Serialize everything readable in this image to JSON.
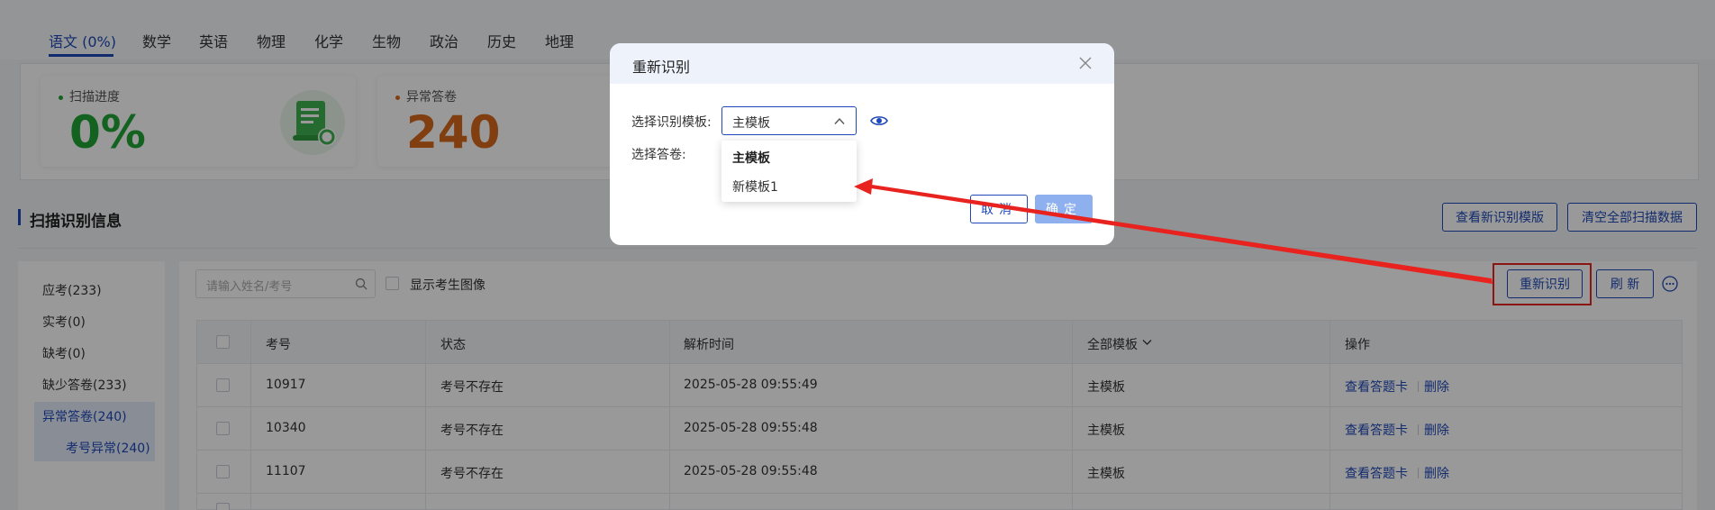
{
  "tabs": [
    {
      "label": "语文 (0%)",
      "active": true
    },
    {
      "label": "数学"
    },
    {
      "label": "英语"
    },
    {
      "label": "物理"
    },
    {
      "label": "化学"
    },
    {
      "label": "生物"
    },
    {
      "label": "政治"
    },
    {
      "label": "历史"
    },
    {
      "label": "地理"
    }
  ],
  "stats": {
    "scan_progress": {
      "label": "扫描进度",
      "value": "0%",
      "color": "#21a335"
    },
    "abnormal": {
      "label": "异常答卷",
      "value": "240",
      "color": "#d8681c"
    }
  },
  "section": {
    "title": "扫描识别信息",
    "view_new_template_btn": "查看新识别模版",
    "clear_all_btn": "清空全部扫描数据"
  },
  "sidebar": {
    "items": [
      {
        "label": "应考(233)"
      },
      {
        "label": "实考(0)"
      },
      {
        "label": "缺考(0)"
      },
      {
        "label": "缺少答卷(233)"
      },
      {
        "label": "异常答卷(240)",
        "active": true
      },
      {
        "label": "考号异常(240)",
        "active": true,
        "sub": true
      }
    ]
  },
  "toolbar": {
    "search_placeholder": "请输入姓名/考号",
    "show_image_label": "显示考生图像",
    "rescan_btn": "重新识别",
    "refresh_btn": "刷 新"
  },
  "table": {
    "headers": [
      "考号",
      "状态",
      "解析时间",
      "全部模板",
      "操作"
    ],
    "rows": [
      {
        "id": "10917",
        "status": "考号不存在",
        "time": "2025-05-28 09:55:49",
        "template": "主模板"
      },
      {
        "id": "10340",
        "status": "考号不存在",
        "time": "2025-05-28 09:55:48",
        "template": "主模板"
      },
      {
        "id": "11107",
        "status": "考号不存在",
        "time": "2025-05-28 09:55:48",
        "template": "主模板"
      }
    ],
    "action_view": "查看答题卡",
    "action_delete": "删除"
  },
  "modal": {
    "title": "重新识别",
    "template_label": "选择识别模板:",
    "template_value": "主模板",
    "sheet_label": "选择答卷:",
    "cancel_btn": "取消",
    "confirm_btn": "确定",
    "dropdown_options": [
      "主模板",
      "新模板1"
    ]
  },
  "colors": {
    "primary": "#1f49b8",
    "annotation_red": "#e8231f"
  }
}
